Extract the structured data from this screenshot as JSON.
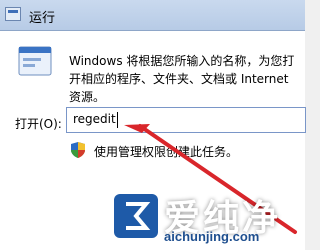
{
  "window": {
    "title": "运行"
  },
  "dialog": {
    "description": "Windows 将根据您所输入的名称，为您打开相应的程序、文件夹、文档或 Internet 资源。",
    "open_label": "打开(O):",
    "command_value": "regedit",
    "admin_note": "使用管理权限创建此任务。"
  },
  "watermark": {
    "title": "爱纯净",
    "site": "aichunjing.com"
  },
  "colors": {
    "arrow": "#d9262b",
    "logo": "#1e5aa8"
  },
  "icons": [
    "run-icon",
    "shield-icon",
    "arrow-annotation",
    "watermark-logo"
  ]
}
